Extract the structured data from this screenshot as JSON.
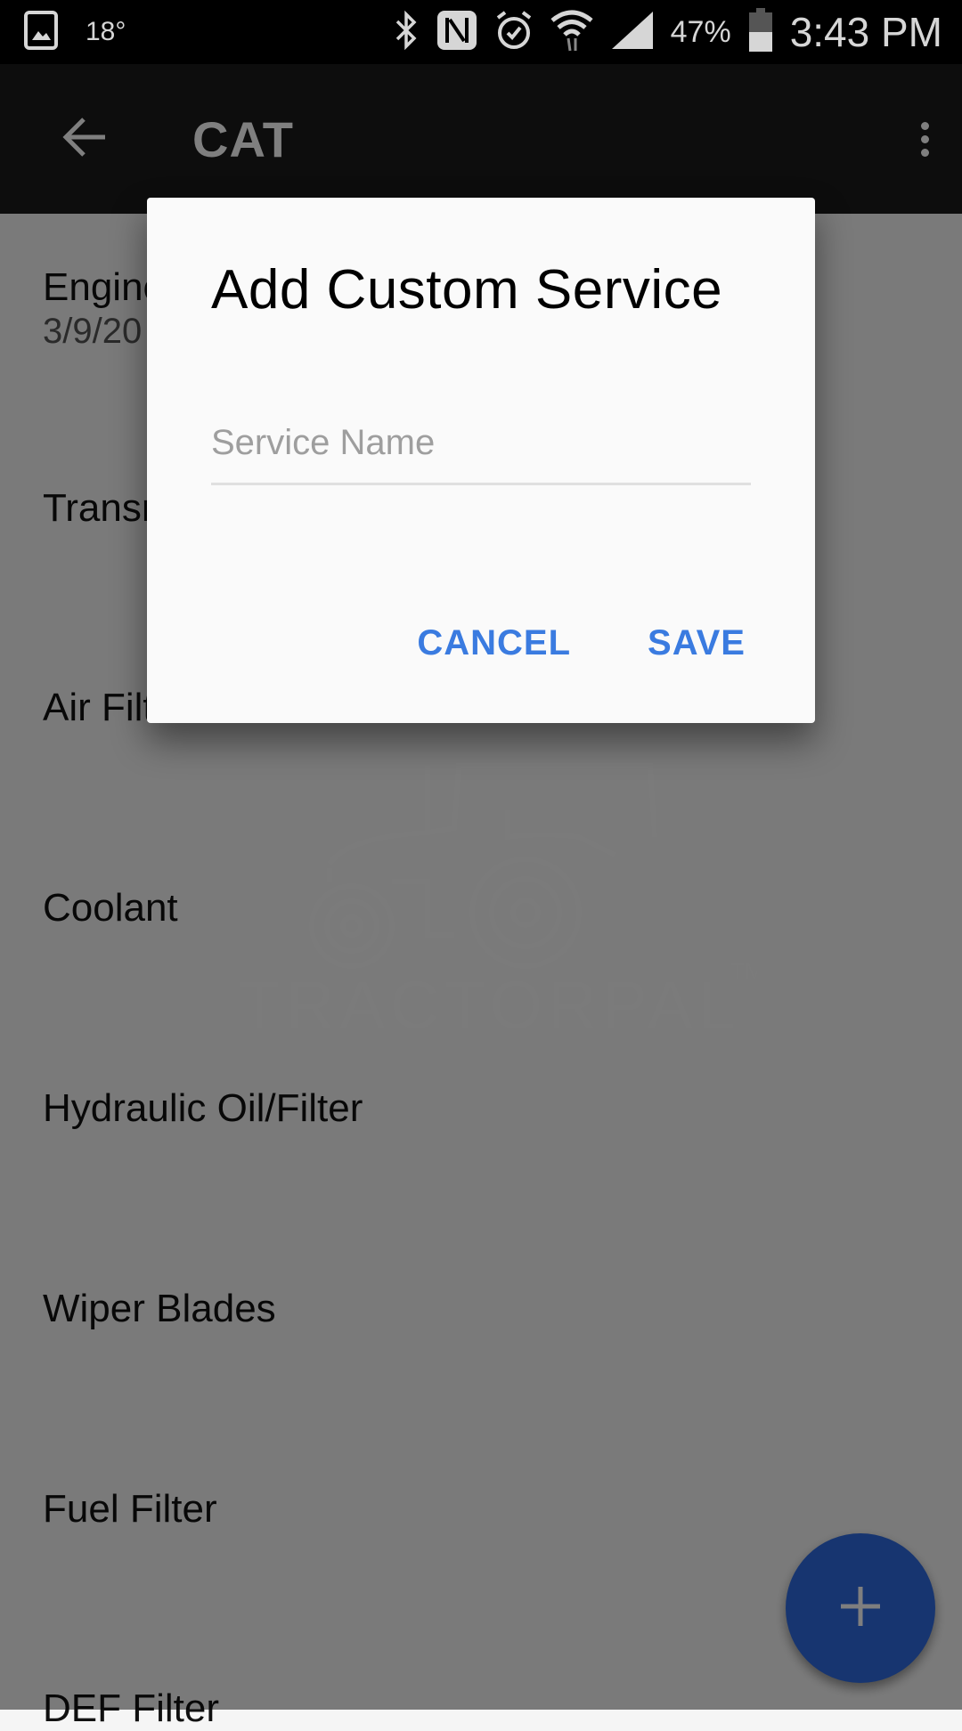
{
  "status_bar": {
    "temperature": "18°",
    "battery_percent": "47%",
    "time": "3:43 PM",
    "icons": [
      "gallery-icon",
      "bluetooth-icon",
      "nfc-icon",
      "alarm-icon",
      "wifi-icon",
      "signal-icon",
      "battery-icon"
    ]
  },
  "app_bar": {
    "title": "CAT",
    "back_icon": "arrow-back-icon",
    "overflow_icon": "more-vert-icon"
  },
  "list": {
    "items": [
      {
        "title": "Engine Oil/Filter",
        "subtitle": "3/9/20"
      },
      {
        "title": "Transmission",
        "subtitle": ""
      },
      {
        "title": "Air Filter",
        "subtitle": ""
      },
      {
        "title": "Coolant",
        "subtitle": ""
      },
      {
        "title": "Hydraulic Oil/Filter",
        "subtitle": ""
      },
      {
        "title": "Wiper Blades",
        "subtitle": ""
      },
      {
        "title": "Fuel Filter",
        "subtitle": ""
      },
      {
        "title": "DEF Filter",
        "subtitle": ""
      }
    ]
  },
  "watermark": {
    "text": "TRACTORPAL",
    "trademark": "TM"
  },
  "fab": {
    "icon": "add-icon"
  },
  "dialog": {
    "title": "Add Custom Service",
    "field_placeholder": "Service Name",
    "field_value": "",
    "cancel_label": "CANCEL",
    "save_label": "SAVE"
  },
  "colors": {
    "accent": "#3a7be0",
    "fab": "#2f6ae0",
    "app_bar": "#1b1b1b"
  }
}
